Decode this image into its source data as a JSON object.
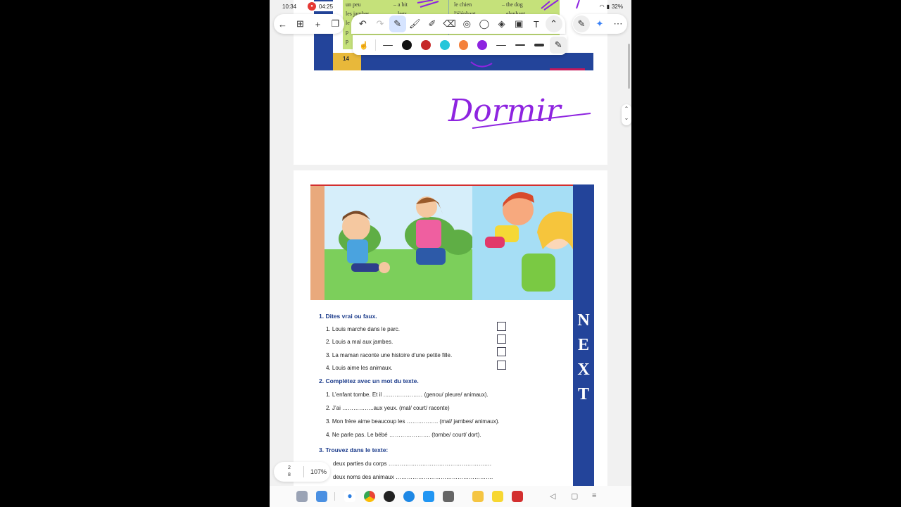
{
  "status": {
    "time": "10:34",
    "record_time": "04:25",
    "battery": "32%"
  },
  "vocab": {
    "col1": [
      "un peu",
      "les jambes",
      "le",
      "p",
      "p"
    ],
    "col2": [
      "– a bit",
      "– legs"
    ],
    "col3": [
      "le chien",
      "l'éléphant"
    ],
    "col4": [
      "– the dog",
      "– elephant"
    ]
  },
  "page1": {
    "page_number": "14",
    "handwriting": "Dormir"
  },
  "next_letters": [
    "N",
    "E",
    "X",
    "T"
  ],
  "exercises": {
    "ex1_title": "1.  Dites vrai ou faux.",
    "ex1_items": [
      "1.  Louis marche dans le parc.",
      "2.  Louis a mal aux jambes.",
      "3.  La maman raconte une histoire d’une petite fille.",
      "4.  Louis aime les animaux."
    ],
    "ex2_title": "2.  Complétez avec un mot du texte.",
    "ex2_items": [
      "1.  L’enfant tombe.  Et il ………………… (genou/ pleure/ animaux).",
      "2.  J’ai ……………..aux yeux. (mal/ court/ raconte)",
      "3.  Mon frère aime beaucoup les …………….. (mal/ jambes/ animaux).",
      "4.  Ne parle pas. Le bébé …………………. (tombe/ court/ dort)."
    ],
    "ex3_title": "3.  Trouvez dans le texte:",
    "ex3_items": [
      "deux parties du corps ……………………………………………….",
      "deux noms des animaux ……………………………………………."
    ]
  },
  "page_indicator": {
    "current": "2",
    "total": "8",
    "zoom": "107%"
  },
  "pen_colors": [
    "#111111",
    "#c62828",
    "#26c6da",
    "#f4813c",
    "#8e24e0"
  ],
  "accent": "#23449a"
}
